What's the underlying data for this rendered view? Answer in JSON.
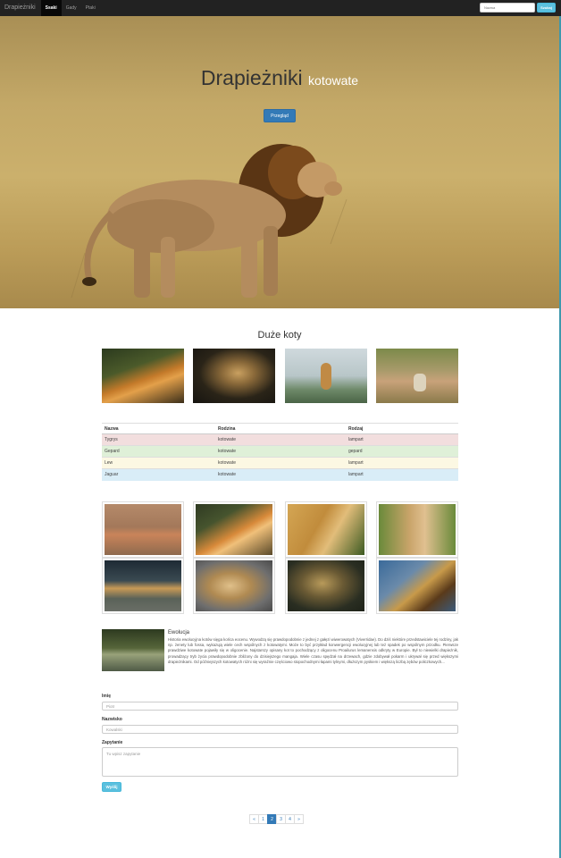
{
  "navbar": {
    "brand": "Drapieżniki",
    "items": [
      "Ssaki",
      "Gady",
      "Ptaki"
    ],
    "search_placeholder": "Nazwa",
    "search_button": "Szukaj"
  },
  "hero": {
    "title": "Drapieżniki",
    "subtitle": "kotowate",
    "button": "Przegląd"
  },
  "section_title": "Duże koty",
  "table": {
    "headers": [
      "Nazwa",
      "Rodzina",
      "Rodzaj"
    ],
    "rows": [
      [
        "Tygrys",
        "kotowate",
        "lampart"
      ],
      [
        "Gepard",
        "kotowate",
        "gepard"
      ],
      [
        "Lew",
        "kotowate",
        "lampart"
      ],
      [
        "Jaguar",
        "kotowate",
        "lampart"
      ]
    ]
  },
  "evolution": {
    "heading": "Ewolucja",
    "text": "Historia ewolucyjna kotów sięga końca eocenu. Wywodzą się prawdopodobnie z jednej z gałęzi wiwerowatych (Viverridae). Do dziś niektóre przedstawiciele tej rodziny, jak np. żenety lub fossa, wykazują wiele cech wspólnych z kotowatymi. Może to być przykład konwergencji ewolucyjnej lub też spadek po wspólnym przodku. Pierwsze prawdziwe kotowate pojawiły się w oligocenie. Najstarszy opisany kot to pochodzący z oligocenu Proailurus lemanensis odkryty w Europie. Był to niewielki drapieżnik, prowadzący tryb życia prawdopodobnie zbliżony do dzisiejszego mangaja. Wiele czasu spędzał na drzewach, gdzie zdobywał pokarm i ukrywał się przed większymi drapieżnikami. Od późniejszych kotowatych różni się wyraźnie częściowo stopochodnymi łapami tylnymi, dłuższym pyskiem i większą liczbą zębów policzkowych..."
  },
  "form": {
    "name_label": "Imię",
    "name_placeholder": "Piotr",
    "surname_label": "Nazwisko",
    "surname_placeholder": "Kowalski",
    "query_label": "Zapytanie",
    "query_placeholder": "Tu wpisz zapytanie",
    "submit": "Wyślij"
  },
  "pagination": [
    "«",
    "1",
    "2",
    "3",
    "4",
    "»"
  ],
  "pagination_active": "2",
  "colors": {
    "navbar_bg": "#222222",
    "primary": "#337ab7",
    "info": "#5bc0de",
    "danger_row": "#f2dede",
    "success_row": "#dff0d8",
    "warning_row": "#fcf8e3",
    "info_row": "#d9edf7"
  },
  "icons": {
    "hero_image": "lion-photo",
    "gallery_top": [
      "tiger-photo",
      "leopard-photo",
      "lioness-photo",
      "jaguar-photo"
    ],
    "gallery_grid": [
      "tiger-photo",
      "tiger-photo",
      "cheetah-photo",
      "cheetah-cub-photo",
      "lion-photo",
      "lion-photo",
      "jaguar-photo",
      "leopard-photo"
    ],
    "evolution_image": "leopard-water-photo"
  }
}
